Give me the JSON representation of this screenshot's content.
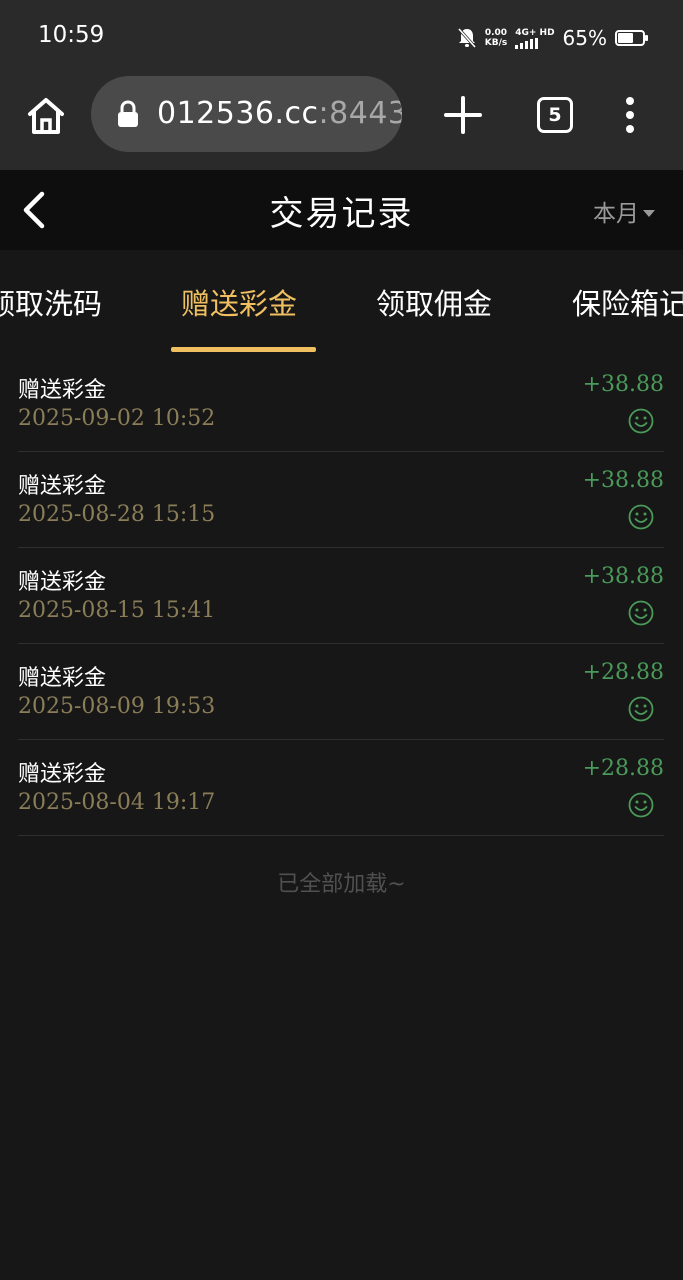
{
  "status_bar": {
    "time": "10:59",
    "net_speed": "0.00",
    "net_speed_unit": "KB/s",
    "network_type": "4G+ HD",
    "battery_percent": "65%",
    "battery_level": 0.65
  },
  "browser": {
    "url_host": "012536.cc",
    "url_port": ":8443",
    "tab_count": "5",
    "icons": [
      "home-icon",
      "lock-icon",
      "plus-icon",
      "more-vertical-icon"
    ]
  },
  "nav": {
    "title": "交易记录",
    "period": "本月"
  },
  "tabs": [
    {
      "label": "领取洗码",
      "active": false
    },
    {
      "label": "赠送彩金",
      "active": true
    },
    {
      "label": "领取佣金",
      "active": false
    },
    {
      "label": "保险箱记",
      "active": false
    }
  ],
  "records": [
    {
      "title": "赠送彩金",
      "time": "2025-09-02 10:52",
      "amount": "+38.88"
    },
    {
      "title": "赠送彩金",
      "time": "2025-08-28 15:15",
      "amount": "+38.88"
    },
    {
      "title": "赠送彩金",
      "time": "2025-08-15 15:41",
      "amount": "+38.88"
    },
    {
      "title": "赠送彩金",
      "time": "2025-08-09 19:53",
      "amount": "+28.88"
    },
    {
      "title": "赠送彩金",
      "time": "2025-08-04 19:17",
      "amount": "+28.88"
    }
  ],
  "footer": {
    "end_text": "已全部加载~"
  },
  "colors": {
    "accent": "#f0c060",
    "amount": "#4a9a5a",
    "time": "#8a7d58"
  }
}
